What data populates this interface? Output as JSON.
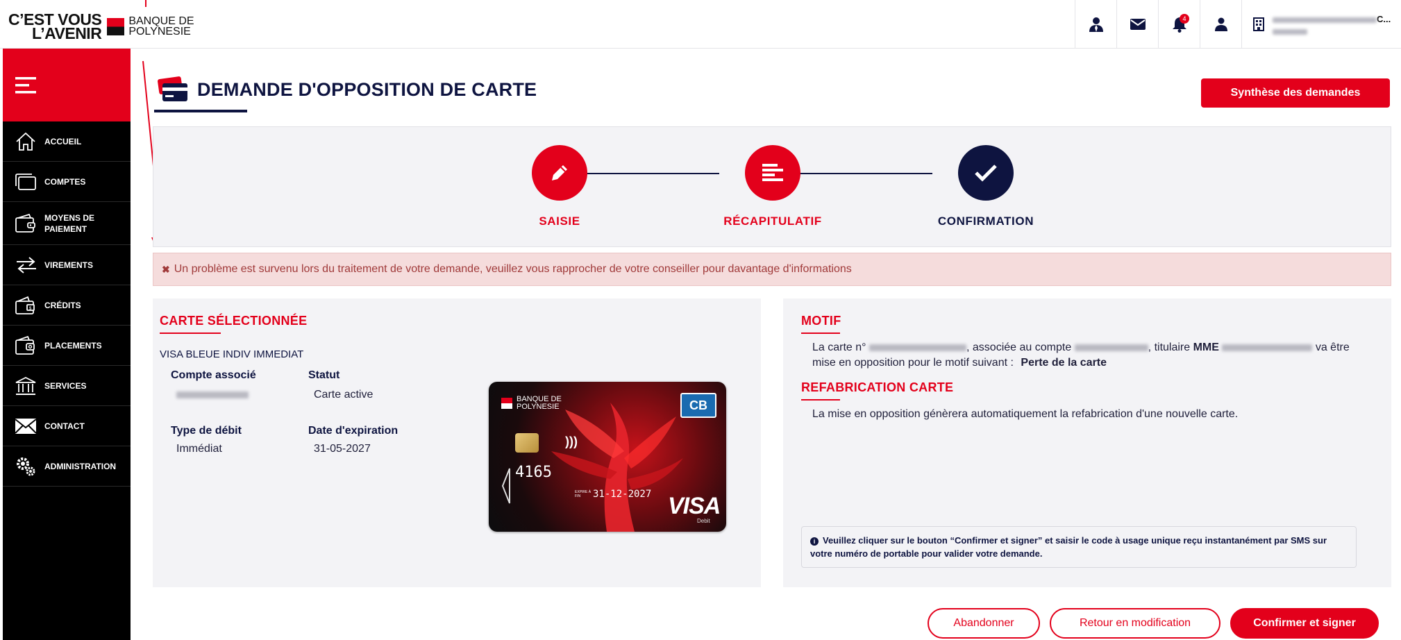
{
  "header": {
    "slogan_line1": "C’EST VOUS",
    "slogan_line2": "L’AVENIR",
    "bank_line1": "BANQUE DE",
    "bank_line2": "POLYNESIE",
    "notification_count": "4",
    "user_name_suffix": "C..."
  },
  "sidebar": {
    "items": [
      {
        "label": "ACCUEIL",
        "icon": "home-icon"
      },
      {
        "label": "COMPTES",
        "icon": "accounts-icon"
      },
      {
        "label": "MOYENS DE PAIEMENT",
        "icon": "wallet-icon"
      },
      {
        "label": "VIREMENTS",
        "icon": "transfer-icon"
      },
      {
        "label": "CRÉDITS",
        "icon": "credit-icon"
      },
      {
        "label": "PLACEMENTS",
        "icon": "savings-icon"
      },
      {
        "label": "SERVICES",
        "icon": "bank-building-icon"
      },
      {
        "label": "CONTACT",
        "icon": "envelope-icon"
      },
      {
        "label": "ADMINISTRATION",
        "icon": "gears-icon"
      }
    ]
  },
  "page": {
    "title": "DEMANDE D'OPPOSITION DE CARTE",
    "synthese_button": "Synthèse des demandes"
  },
  "stepper": {
    "steps": [
      {
        "label": "SAISIE",
        "icon": "pencil-icon",
        "color": "#e3001b"
      },
      {
        "label": "RÉCAPITULATIF",
        "icon": "list-icon",
        "color": "#e3001b"
      },
      {
        "label": "CONFIRMATION",
        "icon": "check-icon",
        "color": "#0e1440"
      }
    ]
  },
  "alert": {
    "text": "Un problème est survenu lors du traitement de votre demande, veuillez vous rapprocher de votre conseiller pour davantage d'informations"
  },
  "card_section": {
    "title": "CARTE SÉLECTIONNÉE",
    "product": "VISA BLEUE INDIV IMMEDIAT",
    "compte_label": "Compte associé",
    "statut_label": "Statut",
    "statut_value": "Carte active",
    "type_debit_label": "Type de débit",
    "type_debit_value": "Immédiat",
    "expiration_label": "Date d'expiration",
    "expiration_value": "31-05-2027"
  },
  "card_image": {
    "bank_line1": "BANQUE DE",
    "bank_line2": "POLYNESIE",
    "cb_logo": "CB",
    "number": "4165",
    "expiry_prefix": "EXPIRE À FIN",
    "expiry": "31-12-2027",
    "brand": "VISA",
    "brand_sub": "Debit"
  },
  "motif": {
    "title": "MOTIF",
    "text_part1": "La carte n°",
    "text_part2": ", associée au compte",
    "text_part3": ", titulaire",
    "titulaire_prefix": "MME",
    "text_part4": "va être mise en opposition pour le motif suivant :",
    "reason": "Perte de la carte"
  },
  "refab": {
    "title": "REFABRICATION CARTE",
    "text": "La mise en opposition génèrera automatiquement la refabrication d'une nouvelle carte."
  },
  "info_box": {
    "text": "Veuillez cliquer sur le bouton “Confirmer et signer” et saisir le code à usage unique reçu instantanément par SMS sur votre numéro de portable pour valider votre demande."
  },
  "actions": {
    "abandon": "Abandonner",
    "retour": "Retour en modification",
    "confirmer": "Confirmer et signer"
  },
  "colors": {
    "brand_red": "#e3001b",
    "navy": "#0e1440",
    "sidebar_bg": "#000000",
    "alert_bg": "#f5dcdc"
  }
}
